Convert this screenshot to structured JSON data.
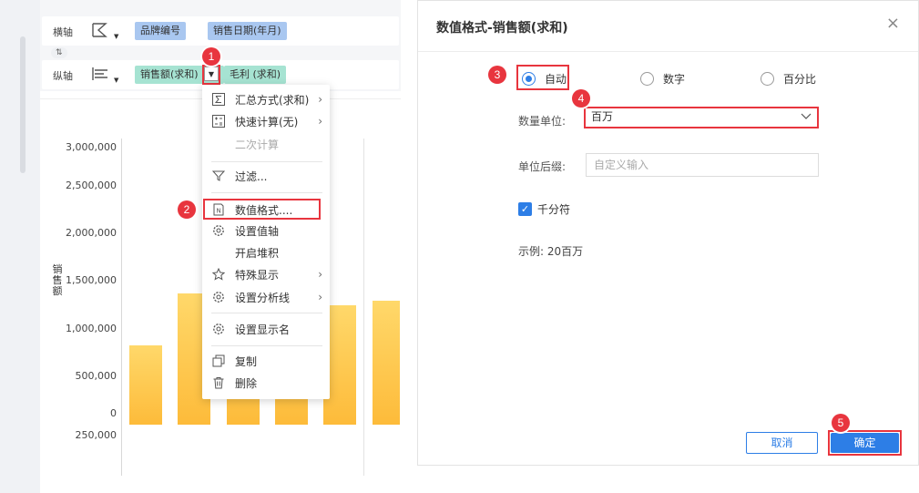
{
  "axes": {
    "x_label": "横轴",
    "y_label": "纵轴",
    "x_fields": [
      "品牌编号",
      "销售日期(年月)"
    ],
    "y_fields": [
      "销售额(求和)",
      "毛利 (求和)"
    ],
    "swap_symbol": "⇅"
  },
  "chart_data": {
    "type": "bar",
    "ylabel": "销售额",
    "yticks": [
      "3,000,000",
      "2,500,000",
      "2,000,000",
      "1,500,000",
      "1,000,000",
      "500,000",
      "0",
      "250,000"
    ],
    "values": [
      860000,
      1420000,
      1310000,
      1360000,
      1290000,
      1340000
    ]
  },
  "menu": {
    "items": [
      {
        "icon": "sigma-icon",
        "label": "汇总方式(求和)",
        "arrow": "›"
      },
      {
        "icon": "quick-calc-icon",
        "label": "快速计算(无)",
        "arrow": "›"
      },
      {
        "icon": "",
        "label": "二次计算",
        "arrow": ""
      },
      {
        "icon": "filter-icon",
        "label": "过滤...",
        "arrow": ""
      },
      {
        "icon": "number-format-icon",
        "label": "数值格式....",
        "arrow": ""
      },
      {
        "icon": "gear-icon",
        "label": "设置值轴",
        "arrow": ""
      },
      {
        "icon": "",
        "label": "开启堆积",
        "arrow": ""
      },
      {
        "icon": "star-icon",
        "label": "特殊显示",
        "arrow": "›"
      },
      {
        "icon": "gear-icon",
        "label": "设置分析线",
        "arrow": "›"
      },
      {
        "icon": "gear-icon",
        "label": "设置显示名",
        "arrow": ""
      },
      {
        "icon": "copy-icon",
        "label": "复制",
        "arrow": ""
      },
      {
        "icon": "trash-icon",
        "label": "删除",
        "arrow": ""
      }
    ]
  },
  "dialog": {
    "title": "数值格式-销售额(求和)",
    "close": "×",
    "radio_options": [
      "自动",
      "数字",
      "百分比"
    ],
    "selected_radio": "自动",
    "unit_label": "数量单位:",
    "unit_value": "百万",
    "suffix_label": "单位后缀:",
    "suffix_placeholder": "自定义输入",
    "thousands_label": "千分符",
    "thousands_checked": true,
    "example": "示例:  20百万",
    "cancel": "取消",
    "ok": "确定"
  },
  "badges": [
    "1",
    "2",
    "3",
    "4",
    "5"
  ],
  "colors": {
    "accent": "#2d7ee6",
    "highlight": "#e8353e",
    "bar": "#fdbb3a",
    "chip_blue": "#a9c7f0",
    "chip_teal": "#a6e3d2"
  }
}
